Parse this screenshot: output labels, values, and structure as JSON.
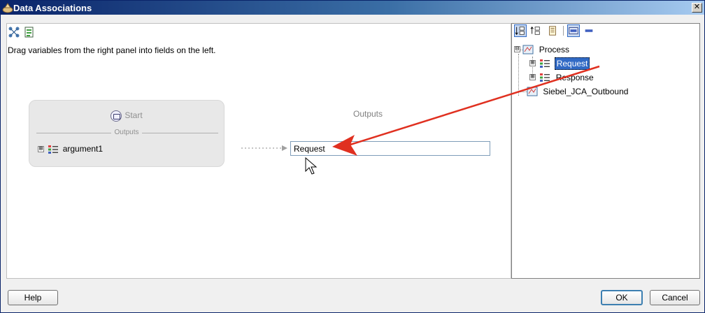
{
  "window": {
    "title": "Data Associations",
    "close_glyph": "✕",
    "title_icon": "data-associations-icon"
  },
  "left_toolbar": {
    "icons": [
      "associations-icon",
      "expression-icon"
    ]
  },
  "instructions": "Drag variables from the right panel into fields on the left.",
  "start_node": {
    "label": "Start",
    "outputs_label": "Outputs",
    "argument": "argument1",
    "expander": "⊞"
  },
  "outputs_column": {
    "header": "Outputs",
    "field_value": "Request"
  },
  "right_toolbar": {
    "icons": [
      "sort-ascending-icon",
      "sort-descending-icon",
      "document-icon",
      "show-panel-icon",
      "collapse-icon"
    ]
  },
  "tree": {
    "expander_collapse": "⊟",
    "expander_expand": "⊞",
    "items": [
      {
        "label": "Process",
        "level": 0
      },
      {
        "label": "Request",
        "level": 1,
        "selected": true
      },
      {
        "label": "Response",
        "level": 1
      },
      {
        "label": "Siebel_JCA_Outbound",
        "level": 0
      }
    ]
  },
  "footer": {
    "help_label": "Help",
    "ok_label": "OK",
    "cancel_label": "Cancel"
  },
  "colors": {
    "title_bar": "#0a246a",
    "selection": "#316ac5",
    "drag_arrow": "#e03020"
  }
}
